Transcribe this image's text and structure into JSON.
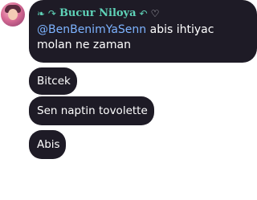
{
  "sender": {
    "name": "Bucur Niloya",
    "leading_symbols": "❧ ↷",
    "trailing_symbol": "↶",
    "heart_symbol": "♡",
    "avatar_icon": "profile-avatar",
    "name_color": "#5fd3b8"
  },
  "messages": [
    {
      "mention": "@BenBenimYaSenn",
      "text": " abis ihtiyac molan ne zaman"
    },
    {
      "text": "Bitcek"
    },
    {
      "text": "Sen naptin tovolette"
    },
    {
      "text": "Abis"
    }
  ],
  "colors": {
    "bubble_background": "#1e1b26",
    "mention": "#7db3ff",
    "text": "#ffffff"
  }
}
